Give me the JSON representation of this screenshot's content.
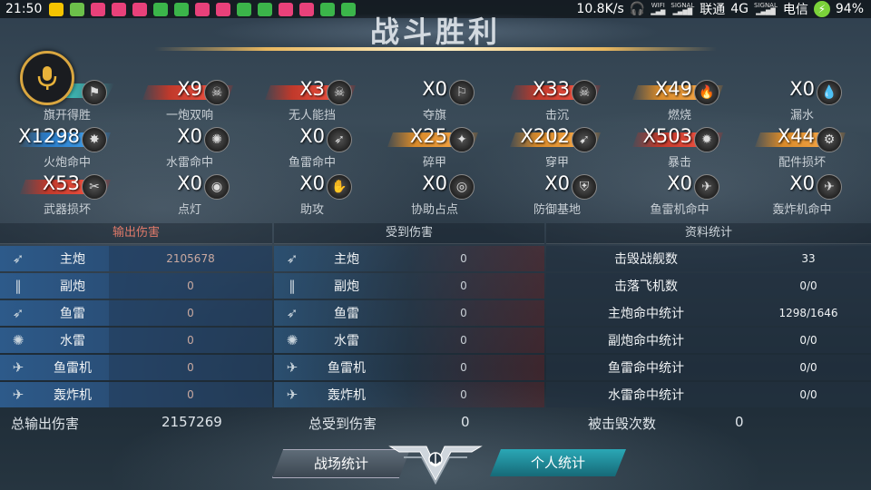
{
  "status_bar": {
    "time": "21:50",
    "speed": "10.8K/s",
    "carrier1": "联通",
    "network": "4G",
    "carrier2": "电信",
    "battery": "94%",
    "wifi_label": "WIFI",
    "signal_label": "SIGNAL"
  },
  "title": "战斗胜利",
  "achievements": [
    {
      "count": "",
      "label": "旗开得胜",
      "icon": "flag-icon",
      "bar": "none"
    },
    {
      "count": "X9",
      "label": "一炮双响",
      "icon": "double-skull-icon",
      "bar": "red"
    },
    {
      "count": "X3",
      "label": "无人能挡",
      "icon": "triple-skull-icon",
      "bar": "red"
    },
    {
      "count": "X0",
      "label": "夺旗",
      "icon": "capture-flag-icon",
      "bar": "none"
    },
    {
      "count": "X33",
      "label": "击沉",
      "icon": "skull-icon",
      "bar": "red"
    },
    {
      "count": "X49",
      "label": "燃烧",
      "icon": "fire-icon",
      "bar": "orange"
    },
    {
      "count": "X0",
      "label": "漏水",
      "icon": "flood-icon",
      "bar": "none"
    },
    {
      "count": "X1298",
      "label": "火炮命中",
      "icon": "cannon-hit-icon",
      "bar": "blue"
    },
    {
      "count": "X0",
      "label": "水雷命中",
      "icon": "mine-icon",
      "bar": "none"
    },
    {
      "count": "X0",
      "label": "鱼雷命中",
      "icon": "torpedo-icon",
      "bar": "none"
    },
    {
      "count": "X25",
      "label": "碎甲",
      "icon": "armor-break-icon",
      "bar": "orange"
    },
    {
      "count": "X202",
      "label": "穿甲",
      "icon": "pierce-icon",
      "bar": "orange"
    },
    {
      "count": "X503",
      "label": "暴击",
      "icon": "critical-icon",
      "bar": "red"
    },
    {
      "count": "X44",
      "label": "配件损坏",
      "icon": "part-damage-icon",
      "bar": "orange"
    },
    {
      "count": "X53",
      "label": "武器损坏",
      "icon": "weapon-damage-icon",
      "bar": "red"
    },
    {
      "count": "X0",
      "label": "点灯",
      "icon": "spot-icon",
      "bar": "none"
    },
    {
      "count": "X0",
      "label": "助攻",
      "icon": "assist-hand-icon",
      "bar": "none"
    },
    {
      "count": "X0",
      "label": "协助占点",
      "icon": "target-icon",
      "bar": "none"
    },
    {
      "count": "X0",
      "label": "防御基地",
      "icon": "shield-icon",
      "bar": "none"
    },
    {
      "count": "X0",
      "label": "鱼雷机命中",
      "icon": "torpedo-plane-icon",
      "bar": "none"
    },
    {
      "count": "X0",
      "label": "轰炸机命中",
      "icon": "bomber-icon",
      "bar": "none"
    }
  ],
  "output_damage": {
    "header": "输出伤害",
    "rows": [
      {
        "label": "主炮",
        "value": "2105678",
        "icon": "main-gun-icon"
      },
      {
        "label": "副炮",
        "value": "0",
        "icon": "secondary-gun-icon"
      },
      {
        "label": "鱼雷",
        "value": "0",
        "icon": "torpedo-icon"
      },
      {
        "label": "水雷",
        "value": "0",
        "icon": "mine-icon"
      },
      {
        "label": "鱼雷机",
        "value": "0",
        "icon": "torpedo-plane-icon"
      },
      {
        "label": "轰炸机",
        "value": "0",
        "icon": "bomber-icon"
      }
    ],
    "total_label": "总输出伤害",
    "total_value": "2157269"
  },
  "received_damage": {
    "header": "受到伤害",
    "rows": [
      {
        "label": "主炮",
        "value": "0",
        "icon": "main-gun-icon"
      },
      {
        "label": "副炮",
        "value": "0",
        "icon": "secondary-gun-icon"
      },
      {
        "label": "鱼雷",
        "value": "0",
        "icon": "torpedo-icon"
      },
      {
        "label": "水雷",
        "value": "0",
        "icon": "mine-icon"
      },
      {
        "label": "鱼雷机",
        "value": "0",
        "icon": "torpedo-plane-icon"
      },
      {
        "label": "轰炸机",
        "value": "0",
        "icon": "bomber-icon"
      }
    ],
    "total_label": "总受到伤害",
    "total_value": "0"
  },
  "stats": {
    "header": "资料统计",
    "rows": [
      {
        "label": "击毁战舰数",
        "value": "33"
      },
      {
        "label": "击落飞机数",
        "value": "0/0"
      },
      {
        "label": "主炮命中统计",
        "value": "1298/1646"
      },
      {
        "label": "副炮命中统计",
        "value": "0/0"
      },
      {
        "label": "鱼雷命中统计",
        "value": "0/0"
      },
      {
        "label": "水雷命中统计",
        "value": "0/0"
      }
    ],
    "total_label": "被击毁次数",
    "total_value": "0"
  },
  "buttons": {
    "battle_stats": "战场统计",
    "personal_stats": "个人统计"
  }
}
